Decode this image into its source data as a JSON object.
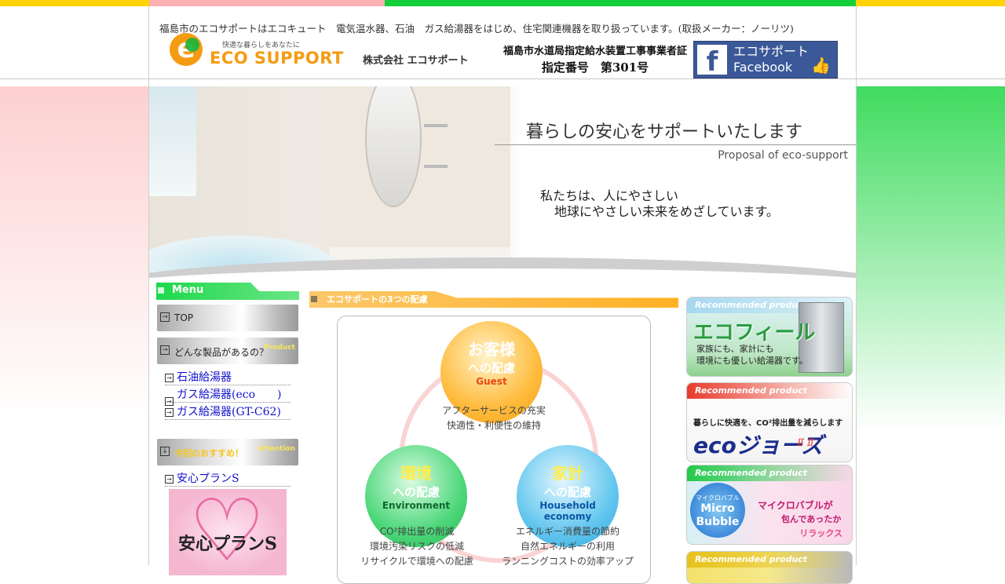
{
  "header": {
    "tagline": "福島市のエコサポートはエコキュート　電気温水器、石油　ガス給湯器をはじめ、住宅関連機器を取り扱っています。(取扱メーカー：ノーリツ)",
    "logo_mark": "e",
    "logo_subtitle": "快適な暮らしをあなたに",
    "logo_name": "ECO SUPPORT",
    "company": "株式会社 エコサポート",
    "cert_line1": "福島市水道局指定給水装置工事事業者証",
    "cert_line2": "指定番号　第301号",
    "facebook_mark": "f",
    "facebook_line1": "エコサポート",
    "facebook_line2": "Facebook"
  },
  "hero": {
    "title": "暮らしの安心をサポートいたします",
    "subtitle": "Proposal of eco-support",
    "message_line1": "私たちは、人にやさしい",
    "message_line2": "地球にやさしい未来をめざしています。"
  },
  "menu": {
    "heading": "Menu",
    "top_button": "TOP",
    "products_button": "どんな製品があるの？",
    "products_tag": "Product",
    "product_links": [
      "石油給湯器",
      "ガス給湯器(eco　　)",
      "ガス給湯器(GT-C62)"
    ],
    "recommend_button": "今回のおすすめ！",
    "recommend_tag": "Attention",
    "recommend_links": [
      "安心プランS"
    ],
    "plan_image_text": "安心プランS"
  },
  "section": {
    "heading": "エコサポートの3つの配慮",
    "guest": {
      "title": "お客様",
      "subtitle": "への配慮",
      "en": "Guest",
      "caption1": "アフターサービスの充実",
      "caption2": "快適性・利便性の維持"
    },
    "environment": {
      "title": "環境",
      "subtitle": "への配慮",
      "en": "Environment",
      "caption1": "CO²排出量の削減",
      "caption2": "環境汚染リスクの低減",
      "caption3": "リサイクルで環境への配慮"
    },
    "household": {
      "title": "家計",
      "subtitle": "への配慮",
      "en": "Household economy",
      "caption1": "エネルギー消費量の節約",
      "caption2": "自然エネルギーの利用",
      "caption3": "ランニングコストの効率アップ"
    }
  },
  "banners": {
    "recommended_label": "Recommended product",
    "ecofeel_title": "エコフィール",
    "ecofeel_line1": "家族にも、家計にも",
    "ecofeel_line2": "環境にも優しい給湯器です。",
    "ecojozu_line": "暮らしに快適を、CO²排出量を減らします",
    "ecojozu_title": "ecoジョーズ",
    "micro_line1": "マイクロバブル",
    "micro_line2": "Micro",
    "micro_line3": "Bubble",
    "micro_text1": "マイクロバブルが",
    "micro_text2": "包んであったか",
    "micro_text3": "リラックス"
  },
  "colors": {
    "top_yellow": "#ffd200",
    "top_pink": "#fbb1b1",
    "top_green": "#12cf3a",
    "link_blue": "#1111cc",
    "menu_green": "#1dd84c",
    "section_orange": "#ffb125"
  }
}
